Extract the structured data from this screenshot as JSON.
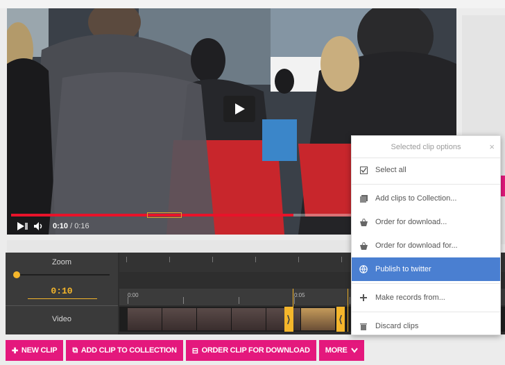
{
  "video": {
    "current_time": "0:10",
    "separator": " / ",
    "duration": "0:16",
    "progress_fraction": 0.64
  },
  "timeline": {
    "zoom_label": "Zoom",
    "timecode": "0:10",
    "video_label": "Video",
    "ruler_mark_start": "0:00",
    "ruler_mark_clip": "0:05"
  },
  "buttons": {
    "new_clip": "NEW CLIP",
    "add_to_collection": "ADD CLIP TO COLLECTION",
    "order_download": "ORDER CLIP FOR DOWNLOAD",
    "more": "MORE"
  },
  "popup": {
    "title": "Selected clip options",
    "close": "×",
    "items": [
      {
        "label": "Select all",
        "icon": "check-square-icon"
      },
      {
        "label": "Add clips to Collection...",
        "icon": "collection-icon"
      },
      {
        "label": "Order for download...",
        "icon": "basket-icon"
      },
      {
        "label": "Order for download for...",
        "icon": "basket-icon"
      },
      {
        "label": "Publish to twitter",
        "icon": "globe-icon"
      },
      {
        "label": "Make records from...",
        "icon": "plus-icon"
      },
      {
        "label": "Discard clips",
        "icon": "trash-icon"
      }
    ]
  },
  "colors": {
    "accent_pink": "#e4187d",
    "timecode_yellow": "#f5b62b",
    "progress_red": "#e8132a",
    "highlight_blue": "#4a7fd1"
  }
}
